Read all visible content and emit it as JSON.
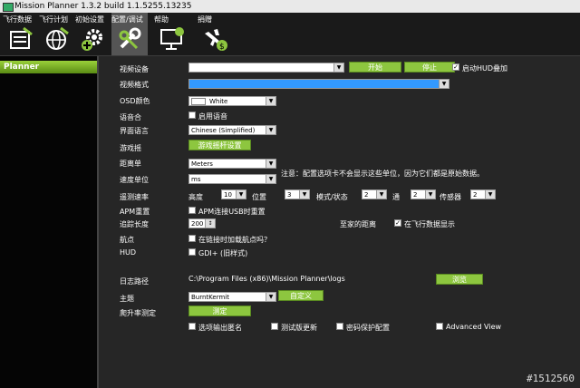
{
  "window": {
    "title": "Mission Planner 1.3.2 build 1.1.5255.13235"
  },
  "toolbar": {
    "items": [
      {
        "label": "飞行数据",
        "icon": "flight-data-icon"
      },
      {
        "label": "飞行计划",
        "icon": "flight-plan-globe-icon"
      },
      {
        "label": "初始设置",
        "icon": "gear-plus-icon"
      },
      {
        "label": "配置/调试",
        "icon": "wrench-icon",
        "active": true
      },
      {
        "label": "帮助",
        "icon": "monitor-help-icon"
      },
      {
        "label": "捐赠",
        "icon": "plane-dollar-icon"
      }
    ]
  },
  "sidebar": {
    "items": [
      {
        "label": "Planner",
        "active": true
      }
    ]
  },
  "form": {
    "video_device": {
      "label": "视频设备",
      "value": "",
      "start": "开始",
      "stop": "停止",
      "hud_overlay": "启动HUD叠加",
      "hud_overlay_checked": true
    },
    "video_format": {
      "label": "视频格式",
      "value": ""
    },
    "osd_color": {
      "label": "OSD颜色",
      "value": "White"
    },
    "speech": {
      "label": "语音合",
      "checkbox_label": "启用语音",
      "checked": false
    },
    "ui_language": {
      "label": "界面语言",
      "value": "Chinese (Simplified)"
    },
    "joystick": {
      "label": "游戏摇",
      "button": "游戏摇杆设置"
    },
    "distance_unit": {
      "label": "距离单",
      "value": "Meters"
    },
    "speed_unit": {
      "label": "速度单位",
      "value": "ms"
    },
    "note": "注意：配置选项卡不会显示这些单位，因为它们都是原始数据。",
    "telemetry_rates": {
      "label": "遥测速率",
      "altitude": {
        "label": "高度",
        "value": "10"
      },
      "position": {
        "label": "位置",
        "value": "3"
      },
      "mode_status": {
        "label": "模式/状态",
        "value": "2"
      },
      "channel": {
        "label": "通",
        "value": "2"
      },
      "sensor": {
        "label": "传感器",
        "value": "2"
      }
    },
    "apm_reset": {
      "label": "APM重置",
      "checkbox_label": "APM连接USB时重置",
      "checked": false
    },
    "track_length": {
      "label": "追踪长度",
      "value": "200"
    },
    "home_distance": "至家的距离",
    "show_in_flight_data": {
      "label": "在飞行数据显示",
      "checked": true
    },
    "waypoints": {
      "label": "航点",
      "checkbox_label": "在链接时加载航点吗？",
      "checked": false
    },
    "hud": {
      "label": "HUD",
      "checkbox_label": "GDI+ (旧样式)",
      "checked": false
    },
    "log_path": {
      "label": "日志路径",
      "value": "C:\\Program Files (x86)\\Mission Planner\\logs",
      "button": "浏览"
    },
    "theme": {
      "label": "主题",
      "value": "BurntKermit",
      "button": "自定义"
    },
    "climb_test": {
      "label": "爬升率测定",
      "button": "测定"
    },
    "options": [
      {
        "label": "选项输出匿名",
        "checked": false
      },
      {
        "label": "测试版更新",
        "checked": false
      },
      {
        "label": "密码保护配置",
        "checked": false
      },
      {
        "label": "Advanced View",
        "checked": false
      }
    ]
  },
  "watermark": "#1512560"
}
